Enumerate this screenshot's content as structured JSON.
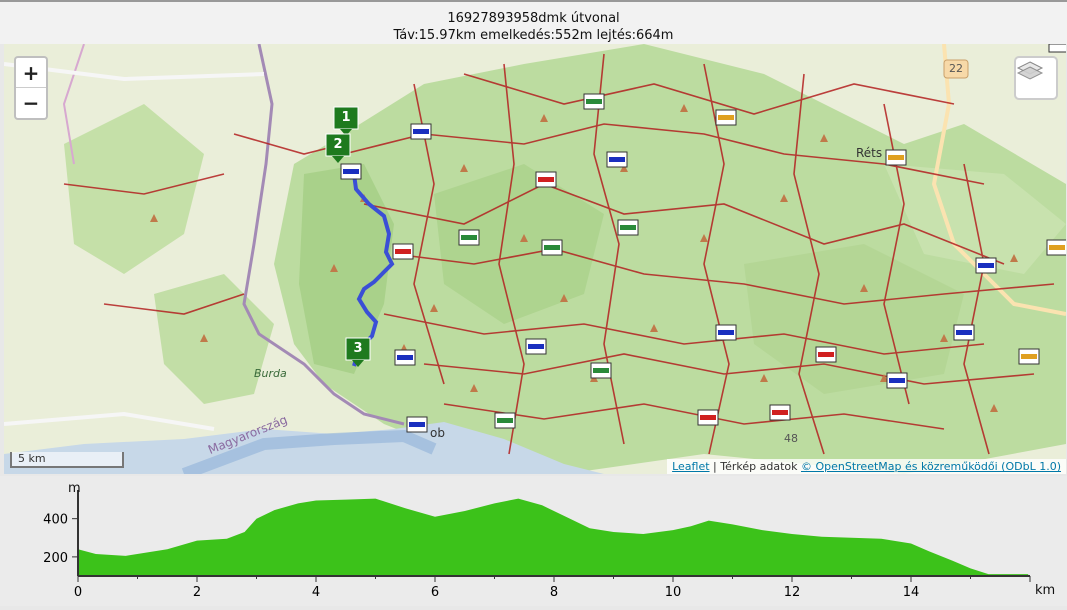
{
  "header": {
    "title": "16927893958dmk útvonal",
    "stats": "Táv:15.97km emelkedés:552m lejtés:664m"
  },
  "map": {
    "zoom_in_label": "+",
    "zoom_out_label": "−",
    "scale_label": "5 km",
    "place_labels": [
      "Burda",
      "Magyarország",
      "Réts",
      "ob",
      "22",
      "48"
    ],
    "route_markers": [
      "1",
      "2",
      "3"
    ],
    "attribution": {
      "leaflet": "Leaflet",
      "separator": " | Térkép adatok ",
      "osm": "© OpenStreetMap és közreműködői (ODbL 1.0)"
    },
    "colors": {
      "route": "#3a4fd6",
      "trail": "#b32020",
      "forest": "#b9d99a",
      "marker": "#1e7a1e"
    }
  },
  "elevation": {
    "y_unit": "m",
    "x_unit": "km",
    "y_ticks": [
      "400",
      "200"
    ],
    "x_ticks": [
      "0",
      "2",
      "4",
      "6",
      "8",
      "10",
      "12",
      "14"
    ]
  },
  "chart_data": {
    "type": "area",
    "xlabel": "km",
    "ylabel": "m",
    "xlim": [
      0,
      15.97
    ],
    "ylim": [
      100,
      550
    ],
    "x": [
      0,
      0.3,
      0.8,
      1.5,
      2.0,
      2.5,
      2.8,
      3.0,
      3.3,
      3.7,
      4.0,
      4.5,
      5.0,
      5.5,
      6.0,
      6.5,
      7.0,
      7.4,
      7.8,
      8.2,
      8.6,
      9.0,
      9.5,
      10.0,
      10.3,
      10.6,
      11.0,
      11.5,
      12.0,
      12.5,
      13.0,
      13.5,
      14.0,
      14.3,
      14.7,
      15.0,
      15.3,
      15.97
    ],
    "values": [
      240,
      215,
      205,
      240,
      285,
      295,
      330,
      400,
      445,
      480,
      495,
      500,
      505,
      455,
      410,
      440,
      480,
      505,
      470,
      410,
      350,
      330,
      320,
      340,
      360,
      390,
      370,
      340,
      320,
      305,
      300,
      295,
      270,
      230,
      180,
      140,
      110,
      110
    ]
  }
}
